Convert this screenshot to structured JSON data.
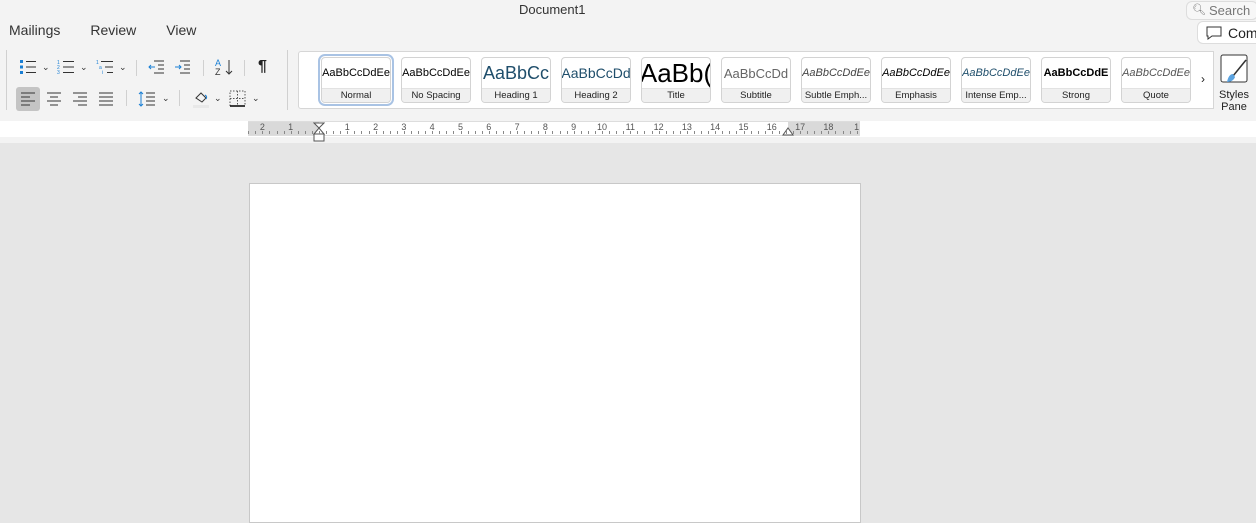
{
  "window": {
    "title": "Document1",
    "search_placeholder": "Search"
  },
  "tabs": [
    "Mailings",
    "Review",
    "View"
  ],
  "comments_label": "Com",
  "paragraph_tools": {
    "bullets": "bullets-icon",
    "numbering": "numbering-icon",
    "multilevel": "multilevel-list-icon",
    "decrease_indent": "decrease-indent-icon",
    "increase_indent": "increase-indent-icon",
    "sort": "sort-icon",
    "show_marks": "pilcrow-icon",
    "align_left": "align-left-icon",
    "align_center": "align-center-icon",
    "align_right": "align-right-icon",
    "justify": "justify-icon",
    "line_spacing": "line-spacing-icon",
    "shading": "shading-icon",
    "borders": "borders-icon",
    "active_alignment": "left"
  },
  "styles": [
    {
      "preview": "AaBbCcDdEe",
      "label": "Normal",
      "selected": true
    },
    {
      "preview": "AaBbCcDdEe",
      "label": "No Spacing"
    },
    {
      "preview": "AaBbCc",
      "label": "Heading 1"
    },
    {
      "preview": "AaBbCcDd",
      "label": "Heading 2"
    },
    {
      "preview": "AaBb(",
      "label": "Title"
    },
    {
      "preview": "AaBbCcDd",
      "label": "Subtitle"
    },
    {
      "preview": "AaBbCcDdEe",
      "label": "Subtle Emph..."
    },
    {
      "preview": "AaBbCcDdEe",
      "label": "Emphasis"
    },
    {
      "preview": "AaBbCcDdEe",
      "label": "Intense Emp..."
    },
    {
      "preview": "AaBbCcDdE",
      "label": "Strong"
    },
    {
      "preview": "AaBbCcDdEe",
      "label": "Quote"
    }
  ],
  "styles_pane": {
    "label1": "Styles",
    "label2": "Pane"
  },
  "ruler": {
    "left_labels": [
      "2",
      "1"
    ],
    "right_labels": [
      "1",
      "2",
      "3",
      "4",
      "5",
      "6",
      "7",
      "8",
      "9",
      "10",
      "11",
      "12",
      "13",
      "14",
      "15",
      "16",
      "17",
      "18",
      "1"
    ]
  },
  "colors": {
    "accent": "#1a7fd4",
    "heading": "#1f4e6b"
  }
}
